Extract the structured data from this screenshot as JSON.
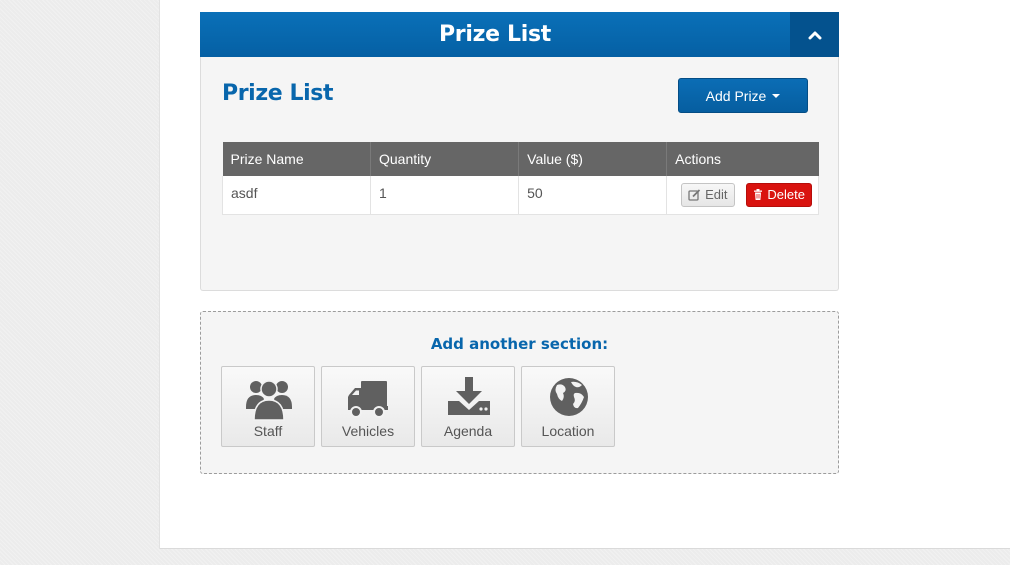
{
  "panel": {
    "header_title": "Prize List",
    "collapse_icon": "chevron-up-icon"
  },
  "prize_list": {
    "title": "Prize List",
    "add_button_label": "Add Prize",
    "columns": [
      "Prize Name",
      "Quantity",
      "Value ($)",
      "Actions"
    ],
    "rows": [
      {
        "name": "asdf",
        "quantity": "1",
        "value": "50",
        "edit_label": "Edit",
        "delete_label": "Delete"
      }
    ]
  },
  "add_section": {
    "title": "Add another section:",
    "tiles": [
      {
        "label": "Staff",
        "icon": "users-icon"
      },
      {
        "label": "Vehicles",
        "icon": "truck-icon"
      },
      {
        "label": "Agenda",
        "icon": "download-icon"
      },
      {
        "label": "Location",
        "icon": "globe-icon"
      }
    ]
  },
  "colors": {
    "brand_blue": "#0866ac",
    "header_blue": "#0a70b8",
    "delete_red": "#d9130f"
  }
}
